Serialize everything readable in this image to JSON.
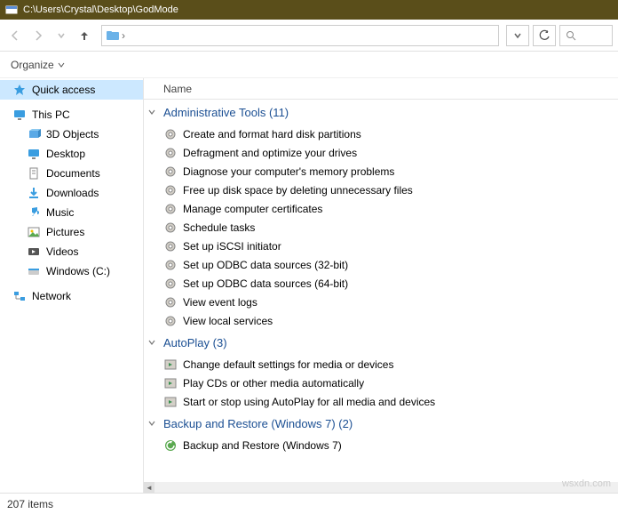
{
  "title": "C:\\Users\\Crystal\\Desktop\\GodMode",
  "toolbar": {
    "organize": "Organize"
  },
  "sidebar": {
    "quick_access": "Quick access",
    "this_pc": "This PC",
    "children": [
      {
        "label": "3D Objects"
      },
      {
        "label": "Desktop"
      },
      {
        "label": "Documents"
      },
      {
        "label": "Downloads"
      },
      {
        "label": "Music"
      },
      {
        "label": "Pictures"
      },
      {
        "label": "Videos"
      },
      {
        "label": "Windows (C:)"
      }
    ],
    "network": "Network"
  },
  "column_header": "Name",
  "groups": [
    {
      "name": "Administrative Tools",
      "count": 11,
      "items": [
        "Create and format hard disk partitions",
        "Defragment and optimize your drives",
        "Diagnose your computer's memory problems",
        "Free up disk space by deleting unnecessary files",
        "Manage computer certificates",
        "Schedule tasks",
        "Set up iSCSI initiator",
        "Set up ODBC data sources (32-bit)",
        "Set up ODBC data sources (64-bit)",
        "View event logs",
        "View local services"
      ]
    },
    {
      "name": "AutoPlay",
      "count": 3,
      "items": [
        "Change default settings for media or devices",
        "Play CDs or other media automatically",
        "Start or stop using AutoPlay for all media and devices"
      ]
    },
    {
      "name": "Backup and Restore (Windows 7)",
      "count": 2,
      "items": [
        "Backup and Restore (Windows 7)"
      ]
    }
  ],
  "status": "207 items",
  "watermark": "wsxdn.com"
}
